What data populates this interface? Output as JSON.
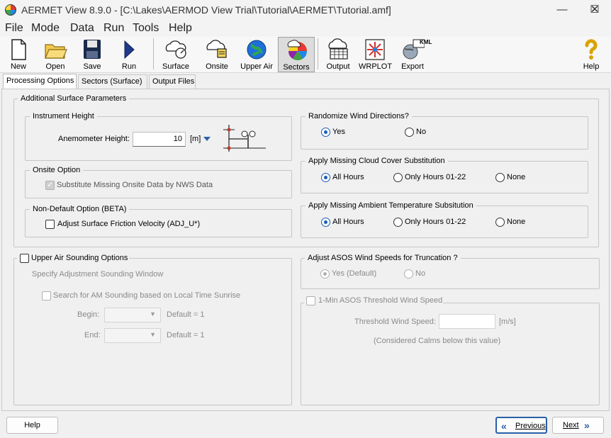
{
  "window": {
    "title": "AERMET View 8.9.0 - [C:\\Lakes\\AERMOD View Trial\\Tutorial\\AERMET\\Tutorial.amf]",
    "minimize": "—",
    "maximize": "☐",
    "close": "✕"
  },
  "menu": [
    "File",
    "Mode",
    "Data",
    "Run",
    "Tools",
    "Help"
  ],
  "toolbar": {
    "new": "New",
    "open": "Open",
    "save": "Save",
    "run": "Run",
    "surface": "Surface",
    "onsite": "Onsite",
    "upper_air": "Upper Air",
    "sectors": "Sectors",
    "output": "Output",
    "wrplot": "WRPLOT",
    "export": "Export",
    "export_badge": "KML",
    "help": "Help"
  },
  "tabs": [
    "Processing Options",
    "Sectors (Surface)",
    "Output Files"
  ],
  "surface_params": {
    "title": "Additional Surface Parameters",
    "instrument_height": {
      "title": "Instrument Height",
      "label": "Anemometer Height:",
      "value": "10",
      "unit": "[m]"
    },
    "onsite_option": {
      "title": "Onsite Option",
      "checkbox": "Substitute Missing Onsite Data by NWS Data"
    },
    "non_default": {
      "title": "Non-Default Option (BETA)",
      "checkbox": "Adjust Surface Friction Velocity (ADJ_U*)"
    },
    "randomize": {
      "title": "Randomize Wind Directions?",
      "yes": "Yes",
      "no": "No"
    },
    "cloud_cover": {
      "title": "Apply Missing Cloud Cover Substitution",
      "all": "All Hours",
      "only": "Only Hours 01-22",
      "none": "None"
    },
    "ambient_temp": {
      "title": "Apply Missing Ambient Temperature Subsitution",
      "all": "All Hours",
      "only": "Only Hours 01-22",
      "none": "None"
    }
  },
  "upper_air": {
    "title": "Upper Air Sounding Options",
    "window_label": "Specify Adjustment Sounding Window",
    "search_label": "Search for AM Sounding based on Local Time Sunrise",
    "begin_label": "Begin:",
    "begin_default": "Default = 1",
    "end_label": "End:",
    "end_default": "Default = 1"
  },
  "asos": {
    "title": "Adjust ASOS Wind Speeds for Truncation ?",
    "yes": "Yes (Default)",
    "no": "No",
    "threshold_title": "1-Min ASOS Threshold Wind Speed",
    "threshold_label": "Threshold Wind Speed:",
    "threshold_unit": "[m/s]",
    "calms_note": "(Considered Calms below this value)"
  },
  "footer": {
    "help": "Help",
    "previous": "Previous",
    "next": "Next"
  }
}
